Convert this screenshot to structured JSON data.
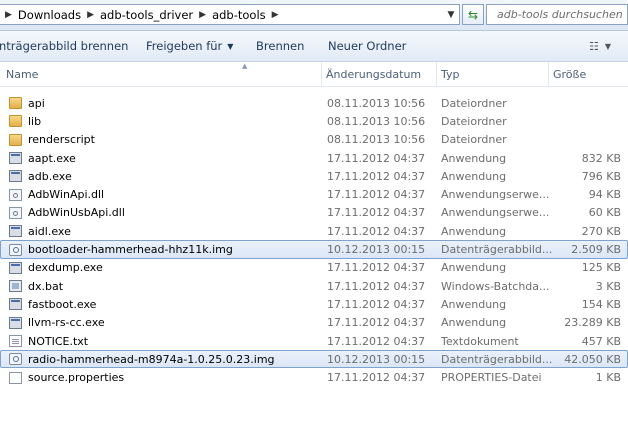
{
  "address": {
    "crumbs": [
      "Downloads",
      "adb-tools_driver",
      "adb-tools"
    ],
    "search_placeholder": "adb-tools durchsuchen"
  },
  "toolbar": {
    "burn_image_label": "nträgerabbild brennen",
    "share_label": "Freigeben für",
    "burn_label": "Brennen",
    "new_folder_label": "Neuer Ordner"
  },
  "columns": {
    "name": "Name",
    "date": "Änderungsdatum",
    "type": "Typ",
    "size": "Größe"
  },
  "files": [
    {
      "name": "api",
      "date": "08.11.2013 10:56",
      "type": "Dateiordner",
      "size": "",
      "icon": "folder-icon"
    },
    {
      "name": "lib",
      "date": "08.11.2013 10:56",
      "type": "Dateiordner",
      "size": "",
      "icon": "folder-icon"
    },
    {
      "name": "renderscript",
      "date": "08.11.2013 10:56",
      "type": "Dateiordner",
      "size": "",
      "icon": "folder-icon"
    },
    {
      "name": "aapt.exe",
      "date": "17.11.2012 04:37",
      "type": "Anwendung",
      "size": "832 KB",
      "icon": "exe-icon"
    },
    {
      "name": "adb.exe",
      "date": "17.11.2012 04:37",
      "type": "Anwendung",
      "size": "796 KB",
      "icon": "exe-icon"
    },
    {
      "name": "AdbWinApi.dll",
      "date": "17.11.2012 04:37",
      "type": "Anwendungserwe...",
      "size": "94 KB",
      "icon": "dll-icon"
    },
    {
      "name": "AdbWinUsbApi.dll",
      "date": "17.11.2012 04:37",
      "type": "Anwendungserwe...",
      "size": "60 KB",
      "icon": "dll-icon"
    },
    {
      "name": "aidl.exe",
      "date": "17.11.2012 04:37",
      "type": "Anwendung",
      "size": "270 KB",
      "icon": "exe-icon"
    },
    {
      "name": "bootloader-hammerhead-hhz11k.img",
      "date": "10.12.2013 00:15",
      "type": "Datenträgerabbild...",
      "size": "2.509 KB",
      "icon": "disc-image-icon",
      "selected": true
    },
    {
      "name": "dexdump.exe",
      "date": "17.11.2012 04:37",
      "type": "Anwendung",
      "size": "125 KB",
      "icon": "exe-icon"
    },
    {
      "name": "dx.bat",
      "date": "17.11.2012 04:37",
      "type": "Windows-Batchda...",
      "size": "3 KB",
      "icon": "batch-icon"
    },
    {
      "name": "fastboot.exe",
      "date": "17.11.2012 04:37",
      "type": "Anwendung",
      "size": "154 KB",
      "icon": "exe-icon"
    },
    {
      "name": "llvm-rs-cc.exe",
      "date": "17.11.2012 04:37",
      "type": "Anwendung",
      "size": "23.289 KB",
      "icon": "exe-icon"
    },
    {
      "name": "NOTICE.txt",
      "date": "17.11.2012 04:37",
      "type": "Textdokument",
      "size": "457 KB",
      "icon": "text-file-icon"
    },
    {
      "name": "radio-hammerhead-m8974a-1.0.25.0.23.img",
      "date": "10.12.2013 00:15",
      "type": "Datenträgerabbild...",
      "size": "42.050 KB",
      "icon": "disc-image-icon",
      "selected": true
    },
    {
      "name": "source.properties",
      "date": "17.11.2012 04:37",
      "type": "PROPERTIES-Datei",
      "size": "1 KB",
      "icon": "properties-file-icon"
    }
  ]
}
